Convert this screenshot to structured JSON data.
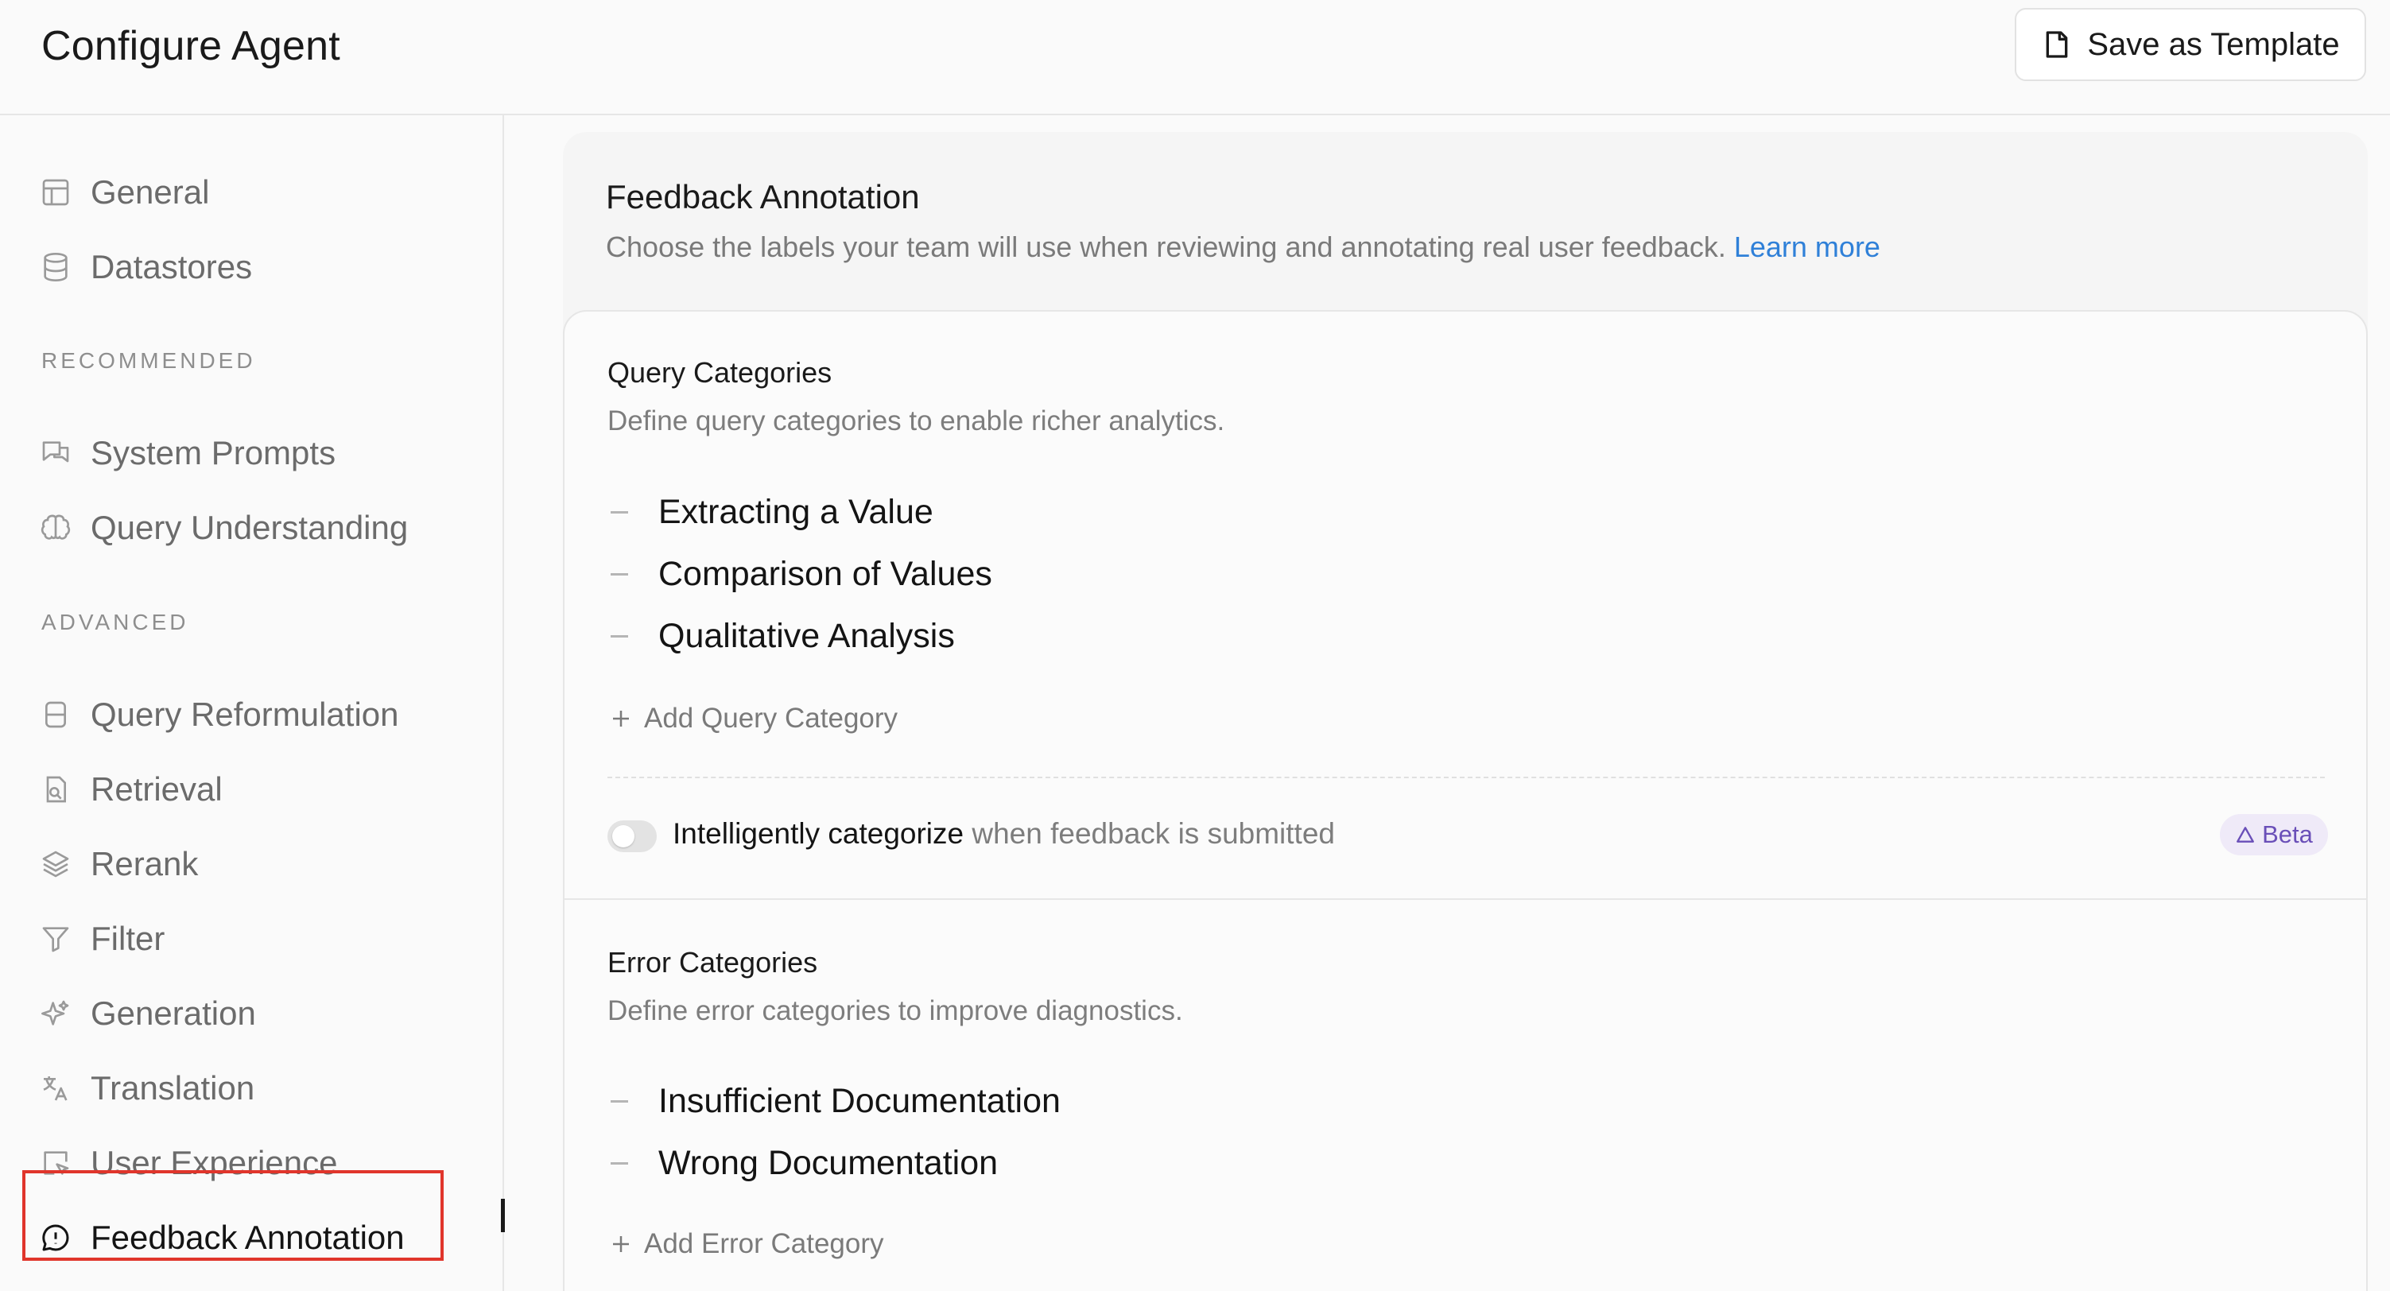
{
  "header": {
    "title": "Configure Agent",
    "save_label": "Save as Template",
    "save_icon": "file-icon"
  },
  "sidebar": {
    "items_top": [
      {
        "label": "General",
        "icon": "layout-icon"
      },
      {
        "label": "Datastores",
        "icon": "database-icon"
      }
    ],
    "recommended_label": "RECOMMENDED",
    "items_recommended": [
      {
        "label": "System Prompts",
        "icon": "chat-bubbles-icon"
      },
      {
        "label": "Query Understanding",
        "icon": "brain-icon"
      }
    ],
    "advanced_label": "ADVANCED",
    "items_advanced": [
      {
        "label": "Query Reformulation",
        "icon": "reformulate-icon"
      },
      {
        "label": "Retrieval",
        "icon": "file-search-icon"
      },
      {
        "label": "Rerank",
        "icon": "layers-icon"
      },
      {
        "label": "Filter",
        "icon": "filter-icon"
      },
      {
        "label": "Generation",
        "icon": "sparkles-icon"
      },
      {
        "label": "Translation",
        "icon": "translate-icon"
      },
      {
        "label": "User Experience",
        "icon": "cursor-window-icon"
      },
      {
        "label": "Feedback Annotation",
        "icon": "message-alert-icon",
        "active": true
      }
    ]
  },
  "panel": {
    "title": "Feedback Annotation",
    "description": "Choose the labels your team will use when reviewing and annotating real user feedback.",
    "learn_more": "Learn more"
  },
  "query_categories": {
    "title": "Query Categories",
    "description": "Define query categories to enable richer analytics.",
    "items": [
      "Extracting a Value",
      "Comparison of Values",
      "Qualitative Analysis"
    ],
    "add_label": "Add Query Category"
  },
  "auto_categorize": {
    "bold": "Intelligently categorize",
    "rest": " when feedback is submitted",
    "enabled": false,
    "badge": "Beta"
  },
  "error_categories": {
    "title": "Error Categories",
    "description": "Define error categories to improve diagnostics.",
    "items": [
      "Insufficient Documentation",
      "Wrong Documentation"
    ],
    "add_label": "Add Error Category"
  },
  "colors": {
    "accent_link": "#2f80d8",
    "highlight_outline": "#e0352b",
    "beta_badge_bg": "#efeaf8",
    "beta_badge_text": "#6a4fb8"
  }
}
